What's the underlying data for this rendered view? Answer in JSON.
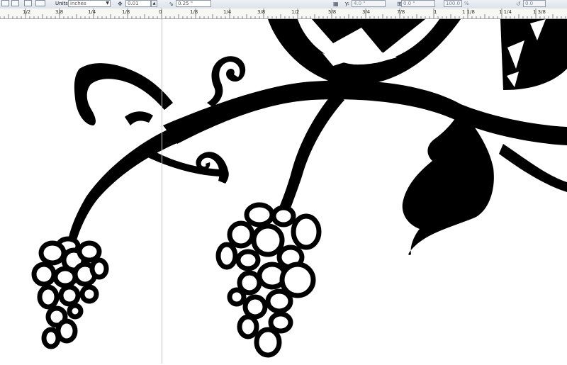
{
  "propbar": {
    "units_label": "Units:",
    "units_value": "inches",
    "nudge_value": "0.01",
    "duplicate_distance": "0.25 \"",
    "y_label": "y:",
    "y_value": "4.0 \"",
    "second_value": "0.0 \"",
    "scale_value": "100.0",
    "angle_value": "0.0"
  },
  "ruler": {
    "labels": [
      "1/2",
      "3/8",
      "1/4",
      "1/8",
      "0",
      "1/8",
      "1/4",
      "3/8",
      "1/2",
      "5/8",
      "3/4",
      "7/8",
      "1",
      "1 1/8",
      "1 1/4",
      "1 3/8"
    ]
  },
  "colors": {
    "ink": "#000000",
    "canvas": "#ffffff",
    "toolbar": "#dde2ea",
    "ruler": "#f7f7f4"
  }
}
